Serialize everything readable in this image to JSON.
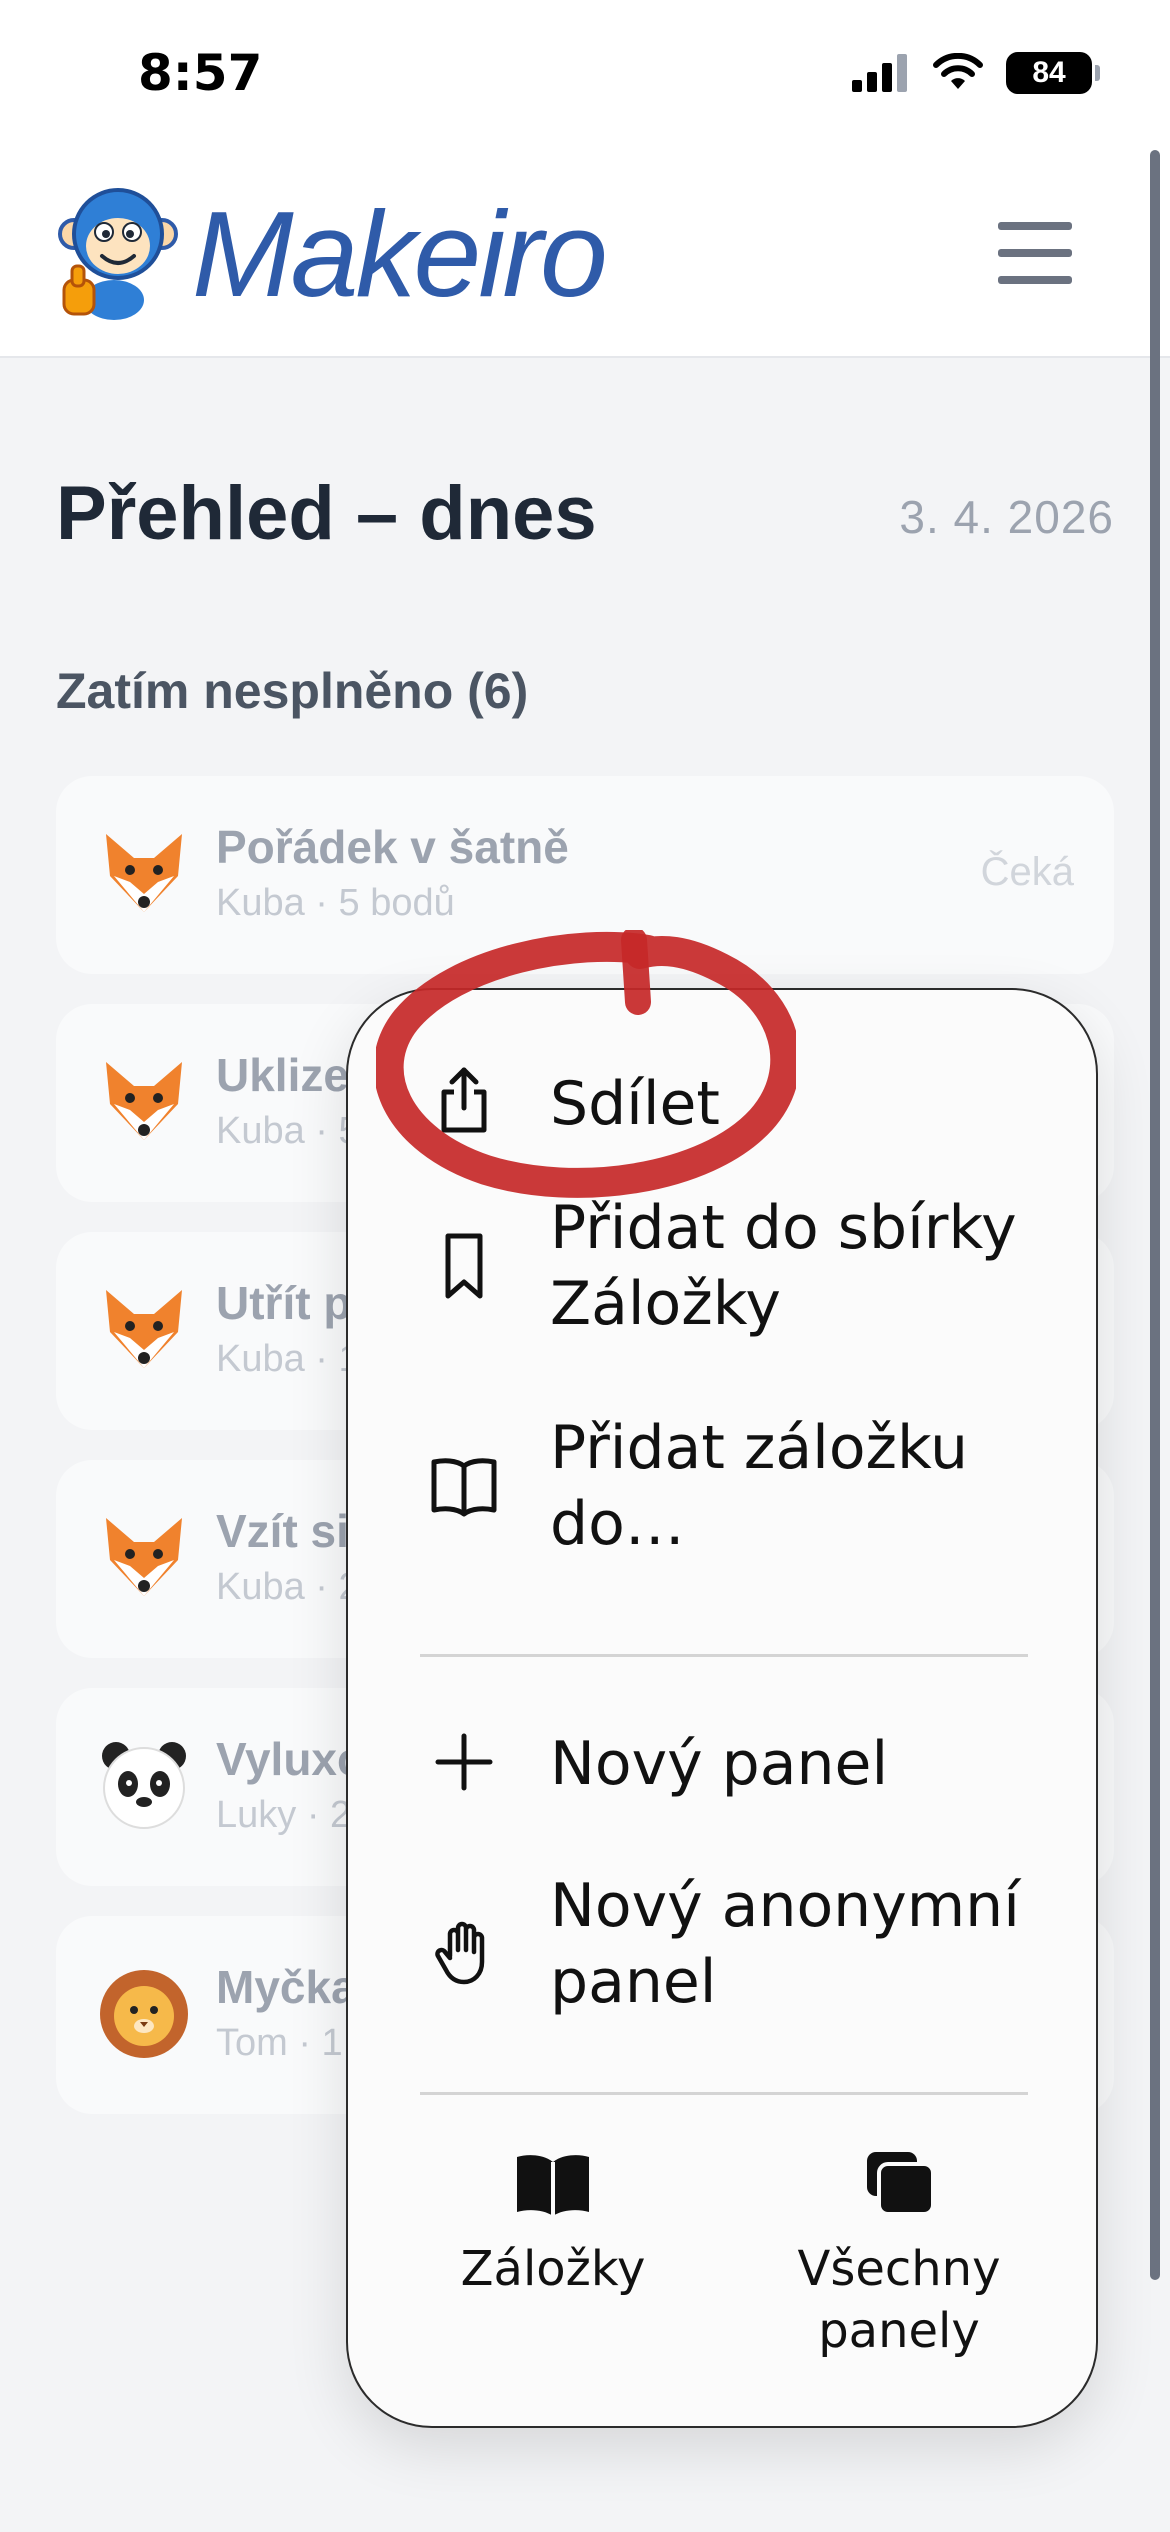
{
  "status_bar": {
    "time": "8:57",
    "battery": "84"
  },
  "header": {
    "logo_text": "Makeiro"
  },
  "main": {
    "title": "Přehled – dnes",
    "date": "3. 4. 2026",
    "section_title": "Zatím nesplněno (6)",
    "tasks": [
      {
        "title": "Pořádek v šatně",
        "subtitle": "Kuba · 5 bodů",
        "status": "Čeká",
        "avatar": "fox-icon"
      },
      {
        "title": "Uklize",
        "subtitle": "Kuba · 5",
        "status": "",
        "avatar": "fox-icon"
      },
      {
        "title": "Utřít p",
        "subtitle": "Kuba · 1",
        "status": "",
        "avatar": "fox-icon"
      },
      {
        "title": "Vzít si",
        "subtitle": "Kuba · 2",
        "status": "",
        "avatar": "fox-icon"
      },
      {
        "title": "Vyluxo",
        "subtitle": "Luky · 2",
        "status": "",
        "avatar": "panda-icon"
      },
      {
        "title": "Myčka",
        "subtitle": "Tom · 1",
        "status": "",
        "avatar": "lion-icon"
      }
    ]
  },
  "menu": {
    "share": "Sdílet",
    "add_bookmarks_collection": "Přidat do sbírky Záložky",
    "add_bookmark_to": "Přidat záložku do…",
    "new_tab": "Nový panel",
    "new_private_tab": "Nový anonymní panel",
    "bookmarks": "Záložky",
    "all_tabs": "Všechny panely"
  },
  "colors": {
    "accent": "#2f5ba9",
    "annotation": "#c62828"
  }
}
